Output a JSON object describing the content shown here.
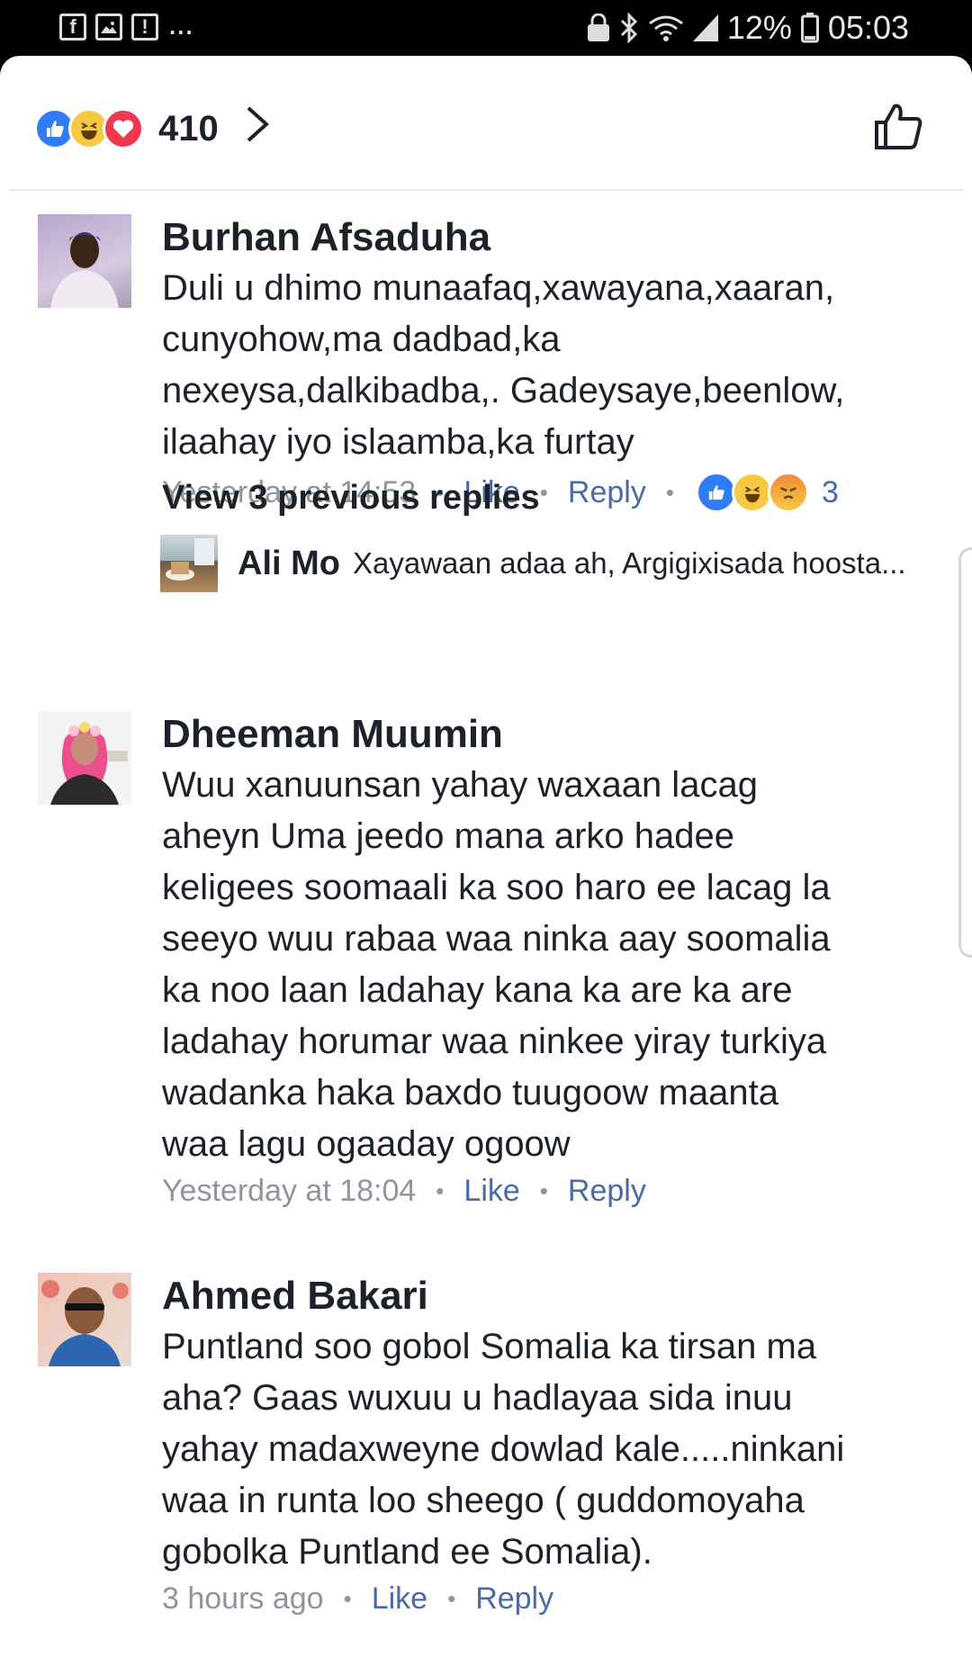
{
  "status_bar": {
    "battery": "12%",
    "time": "05:03",
    "icons": [
      "facebook-icon",
      "gallery-icon",
      "alert-icon",
      "bluetooth-icon",
      "wifi-icon",
      "signal-icon",
      "battery-icon"
    ],
    "more": "..."
  },
  "header": {
    "reaction_icons": [
      "like",
      "haha",
      "love"
    ],
    "reaction_count": "410"
  },
  "comments": [
    {
      "author": "Burhan Afsaduha",
      "text": "Duli u dhimo munaafaq,xawayana,xaaran,\ncunyohow,ma dadbad,ka\nnexeysa,dalkibadba,. Gadeysaye,beenlow,\nilaahay iyo islaamba,ka furtay",
      "time": "Yesterday at 14:53",
      "like_label": "Like",
      "reply_label": "Reply",
      "reaction_icons": [
        "like",
        "haha",
        "angry"
      ],
      "reaction_count": "3",
      "view_previous": "View 3 previous replies",
      "reply_preview": {
        "author": "Ali Mo",
        "text": "Xayawaan adaa ah, Argigixisada hoosta..."
      }
    },
    {
      "author": "Dheeman Muumin",
      "text": "Wuu xanuunsan yahay waxaan lacag\naheyn Uma jeedo mana arko hadee\nkeligees soomaali ka soo haro ee lacag la\nseeyo wuu rabaa waa ninka aay soomalia\nka noo laan ladahay kana ka are ka are\nladahay horumar waa ninkee yiray turkiya\nwadanka haka baxdo tuugoow maanta\nwaa lagu ogaaday ogoow",
      "time": "Yesterday at 18:04",
      "like_label": "Like",
      "reply_label": "Reply"
    },
    {
      "author": "Ahmed Bakari",
      "text": "Puntland soo gobol Somalia ka tirsan ma\naha? Gaas wuxuu u hadlayaa sida inuu\nyahay madaxweyne dowlad kale.....ninkani\nwaa in runta loo sheego ( guddomoyaha\ngobolka Puntland ee Somalia).",
      "time": "3 hours ago",
      "like_label": "Like",
      "reply_label": "Reply"
    }
  ],
  "colors": {
    "like_blue": "#2f7cf6",
    "love_red": "#f0394e",
    "haha_yellow": "#f7c842",
    "link_blue": "#4b6aa3",
    "muted_gray": "#90949c",
    "text": "#1d2129"
  }
}
